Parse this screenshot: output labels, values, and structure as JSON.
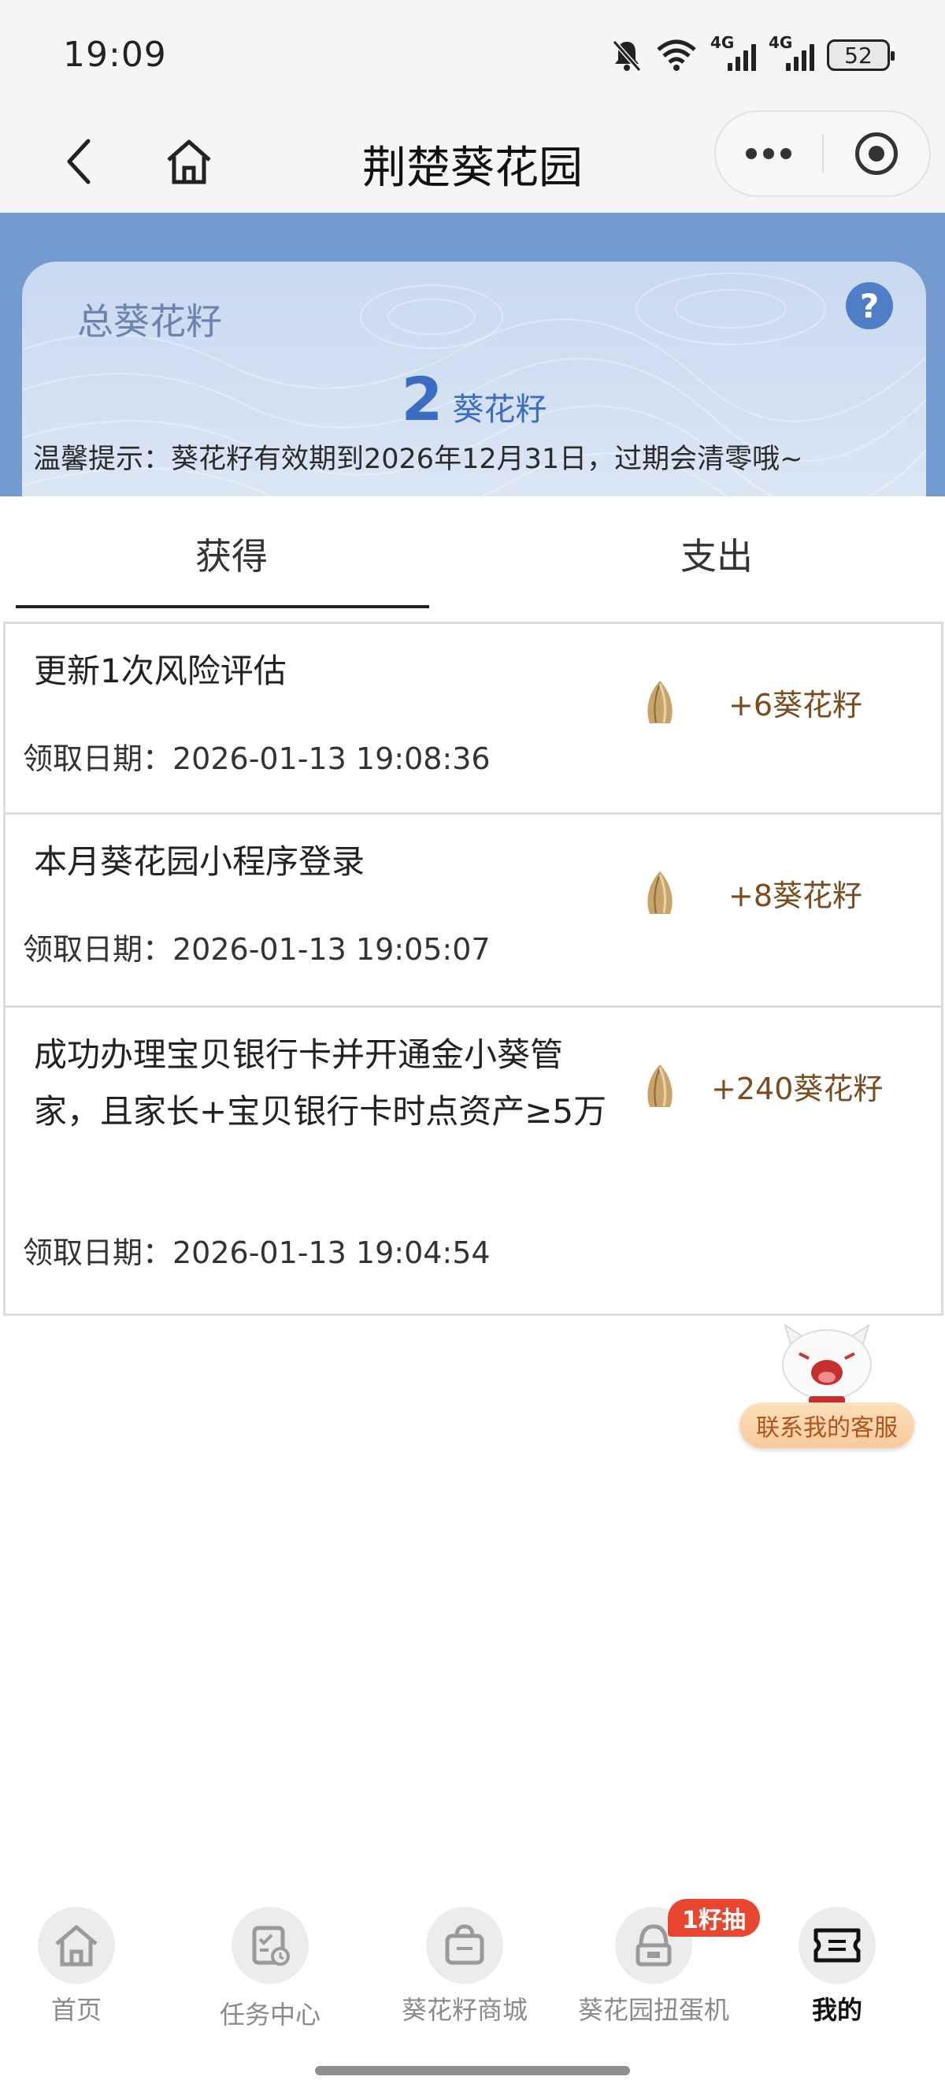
{
  "status_bar": {
    "time": "19:09",
    "battery": "52",
    "net1": "4G",
    "net2": "4G"
  },
  "nav": {
    "title": "荆楚葵花园"
  },
  "summary": {
    "label": "总葵花籽",
    "help": "?",
    "value": "2",
    "unit": "葵花籽",
    "notice": "温馨提示：葵花籽有效期到2026年12月31日，过期会清零哦~"
  },
  "tabs": {
    "earn": "获得",
    "spend": "支出",
    "active": "earn"
  },
  "records": [
    {
      "title": "更新1次风险评估",
      "date": "领取日期：2026-01-13 19:08:36",
      "points": "+6葵花籽"
    },
    {
      "title": "本月葵花园小程序登录",
      "date": "领取日期：2026-01-13 19:05:07",
      "points": "+8葵花籽"
    },
    {
      "title": "成功办理宝贝银行卡并开通金小葵管家，且家长+宝贝银行卡时点资产≥5万",
      "date": "领取日期：2026-01-13 19:04:54",
      "points": "+240葵花籽"
    }
  ],
  "service": {
    "label": "联系我的客服"
  },
  "tabbar": {
    "items": [
      {
        "label": "首页",
        "icon": "home-icon"
      },
      {
        "label": "任务中心",
        "icon": "task-calendar-icon"
      },
      {
        "label": "葵花籽商城",
        "icon": "shopping-bag-icon"
      },
      {
        "label": "葵花园扭蛋机",
        "icon": "gacha-machine-icon",
        "badge": "1籽抽"
      },
      {
        "label": "我的",
        "icon": "ticket-icon",
        "active": true
      }
    ]
  },
  "colors": {
    "header_blue": "#739bd0",
    "accent_blue": "#3a6cc2",
    "points_brown": "#7a4b1e",
    "badge_red": "#e8462f"
  }
}
